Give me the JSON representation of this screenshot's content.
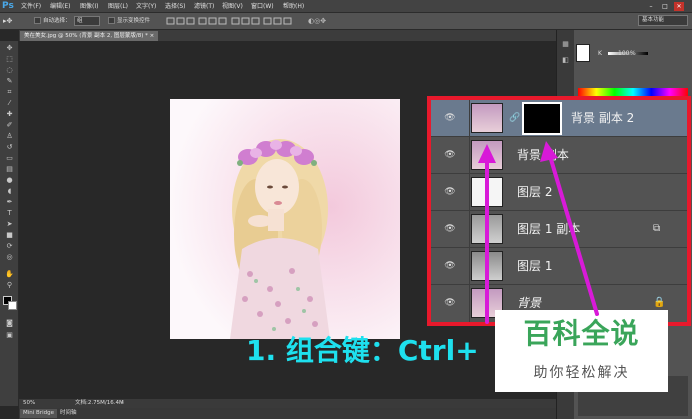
{
  "app": {
    "logo": "Ps"
  },
  "menubar": {
    "items": [
      {
        "label": "文件(F)"
      },
      {
        "label": "编辑(E)"
      },
      {
        "label": "图像(I)"
      },
      {
        "label": "图层(L)"
      },
      {
        "label": "文字(Y)"
      },
      {
        "label": "选择(S)"
      },
      {
        "label": "滤镜(T)"
      },
      {
        "label": "视图(V)"
      },
      {
        "label": "窗口(W)"
      },
      {
        "label": "帮助(H)"
      }
    ],
    "window_controls": {
      "minimize": "–",
      "maximize": "□",
      "close": "✕"
    }
  },
  "options_bar": {
    "auto_select_label": "自动选择：",
    "auto_select_value": "组",
    "show_transform_label": "显示变换控件",
    "workspace": "基本功能"
  },
  "document_tab": {
    "title": "美在美女.jpg @ 50% (背景 副本 2, 图层蒙版/8) *",
    "close": "×"
  },
  "status": {
    "zoom": "50%",
    "doc_size": "文档:2.75M/16.4M"
  },
  "bottom_tabs": [
    {
      "label": "Mini Bridge"
    },
    {
      "label": "时间轴"
    }
  ],
  "color_panel": {
    "channel": "K",
    "value": "100",
    "unit": "%"
  },
  "layers": [
    {
      "name": "背景 副本 2",
      "selected": true,
      "has_mask": true,
      "chain_icon": "chain-icon"
    },
    {
      "name": "背景 副本",
      "selected": false
    },
    {
      "name": "图层 2",
      "selected": false
    },
    {
      "name": "图层 1 副本",
      "selected": false,
      "badge_icon": "smart-object-icon"
    },
    {
      "name": "图层 1",
      "selected": false
    },
    {
      "name": "背景",
      "selected": false,
      "italic": true,
      "lock_icon": "lock-icon"
    }
  ],
  "caption": {
    "text": "1. 组合键：Ctrl+"
  },
  "watermark": {
    "title": "百科全说",
    "subtitle": "助你轻松解决"
  },
  "colors": {
    "highlight": "#e8192c",
    "arrow": "#d81ad8",
    "caption": "#1ee0ee",
    "watermark_title": "#3aa55a"
  }
}
